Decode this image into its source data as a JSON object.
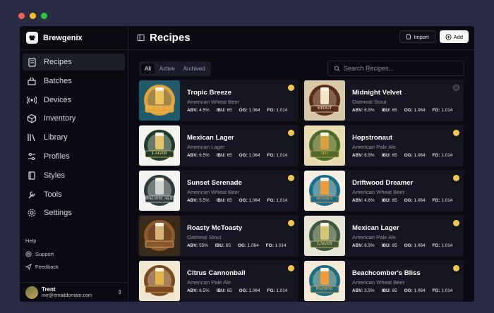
{
  "app": {
    "name": "Brewgenix"
  },
  "window_dots": [
    "#ff5f57",
    "#febc2e",
    "#28c840"
  ],
  "sidebar": {
    "items": [
      {
        "label": "Recipes",
        "icon": "recipe-book-icon",
        "active": true
      },
      {
        "label": "Batches",
        "icon": "batches-icon",
        "active": false
      },
      {
        "label": "Devices",
        "icon": "devices-icon",
        "active": false
      },
      {
        "label": "Inventory",
        "icon": "inventory-icon",
        "active": false
      },
      {
        "label": "Library",
        "icon": "library-icon",
        "active": false
      },
      {
        "label": "Profiles",
        "icon": "profiles-icon",
        "active": false
      },
      {
        "label": "Styles",
        "icon": "styles-icon",
        "active": false
      },
      {
        "label": "Tools",
        "icon": "tools-icon",
        "active": false
      },
      {
        "label": "Settings",
        "icon": "gear-icon",
        "active": false
      }
    ],
    "help": {
      "title": "Help",
      "items": [
        {
          "label": "Support",
          "icon": "support-icon"
        },
        {
          "label": "Feedback",
          "icon": "send-icon"
        }
      ]
    },
    "user": {
      "name": "Trent",
      "email": "me@emaildomain.com"
    }
  },
  "header": {
    "title": "Recipes",
    "import_label": "Import",
    "add_label": "Add"
  },
  "filters": {
    "tabs": [
      "All",
      "Active",
      "Archived"
    ],
    "selected": "All"
  },
  "search": {
    "placeholder": "Search Recipes...",
    "value": ""
  },
  "colors": {
    "accent_dot": "#f2c94c",
    "inactive_dot": "#2a2c38"
  },
  "recipes": [
    {
      "name": "Tropic Breeze",
      "style": "American Wheat Beer",
      "abv": "4.5%",
      "ibu": "65",
      "og": "1.064",
      "fg": "1.014",
      "status": "active"
    },
    {
      "name": "Midnight Velvet",
      "style": "Oatmeal Stout",
      "abv": "6.5%",
      "ibu": "65",
      "og": "1.064",
      "fg": "1.014",
      "status": "inactive"
    },
    {
      "name": "Mexican Lager",
      "style": "American Lager",
      "abv": "6.5%",
      "ibu": "65",
      "og": "1.064",
      "fg": "1.014",
      "status": "active"
    },
    {
      "name": "Hopstronaut",
      "style": "American Pale Ale",
      "abv": "6.5%",
      "ibu": "65",
      "og": "1.064",
      "fg": "1.014",
      "status": "active"
    },
    {
      "name": "Sunset Serenade",
      "style": "American Wheat Beer",
      "abv": "5.5%",
      "ibu": "65",
      "og": "1.064",
      "fg": "1.014",
      "status": "active"
    },
    {
      "name": "Driftwood Dreamer",
      "style": "American Wheat Beer",
      "abv": "4.6%",
      "ibu": "65",
      "og": "1.064",
      "fg": "1.014",
      "status": "active"
    },
    {
      "name": "Roasty McToasty",
      "style": "Oatmeal Stout",
      "abv": "55%",
      "ibu": "65",
      "og": "1.064",
      "fg": "1.014",
      "status": "active"
    },
    {
      "name": "Mexican Lager",
      "style": "American Pale Ale",
      "abv": "6.5%",
      "ibu": "65",
      "og": "1.064",
      "fg": "1.014",
      "status": "active"
    },
    {
      "name": "Citrus Cannonball",
      "style": "American Pale Ale",
      "abv": "6.5%",
      "ibu": "65",
      "og": "1.064",
      "fg": "1.014",
      "status": "active"
    },
    {
      "name": "Beachcomber's Bliss",
      "style": "American Wheat Beer",
      "abv": "3.5%",
      "ibu": "65",
      "og": "1.064",
      "fg": "1.014",
      "status": "active"
    }
  ],
  "thumbs": [
    {
      "bg": "#1f5a6b",
      "ring": "#e3a23b",
      "text": "PACIFIC ALE",
      "fg": "#f0c35a"
    },
    {
      "bg": "#d7c9a8",
      "ring": "#5a2a1a",
      "text": "STOUT",
      "fg": "#f2e6c8"
    },
    {
      "bg": "#f4f2ec",
      "ring": "#1d3d2a",
      "text": "LAGER",
      "fg": "#e4c66a"
    },
    {
      "bg": "#e9dcb2",
      "ring": "#4c6a2a",
      "text": "IPA",
      "fg": "#d8a13c"
    },
    {
      "bg": "#f4f3ef",
      "ring": "#2e3b3f",
      "text": "PACIFIC ALE",
      "fg": "#cfd6d2"
    },
    {
      "bg": "#f5efe2",
      "ring": "#1c6f88",
      "text": "SUNSET",
      "fg": "#f09a3a"
    },
    {
      "bg": "#3a2a1a",
      "ring": "#8a5a2a",
      "text": "",
      "fg": "#d9b27a"
    },
    {
      "bg": "#e9e5d6",
      "ring": "#3f5a3a",
      "text": "LAGER",
      "fg": "#d8c470"
    },
    {
      "bg": "#efe7cf",
      "ring": "#7a4a22",
      "text": "",
      "fg": "#e3b24a"
    },
    {
      "bg": "#f4ead6",
      "ring": "#1e6d7e",
      "text": "PACIFIC",
      "fg": "#f29a3a"
    }
  ]
}
